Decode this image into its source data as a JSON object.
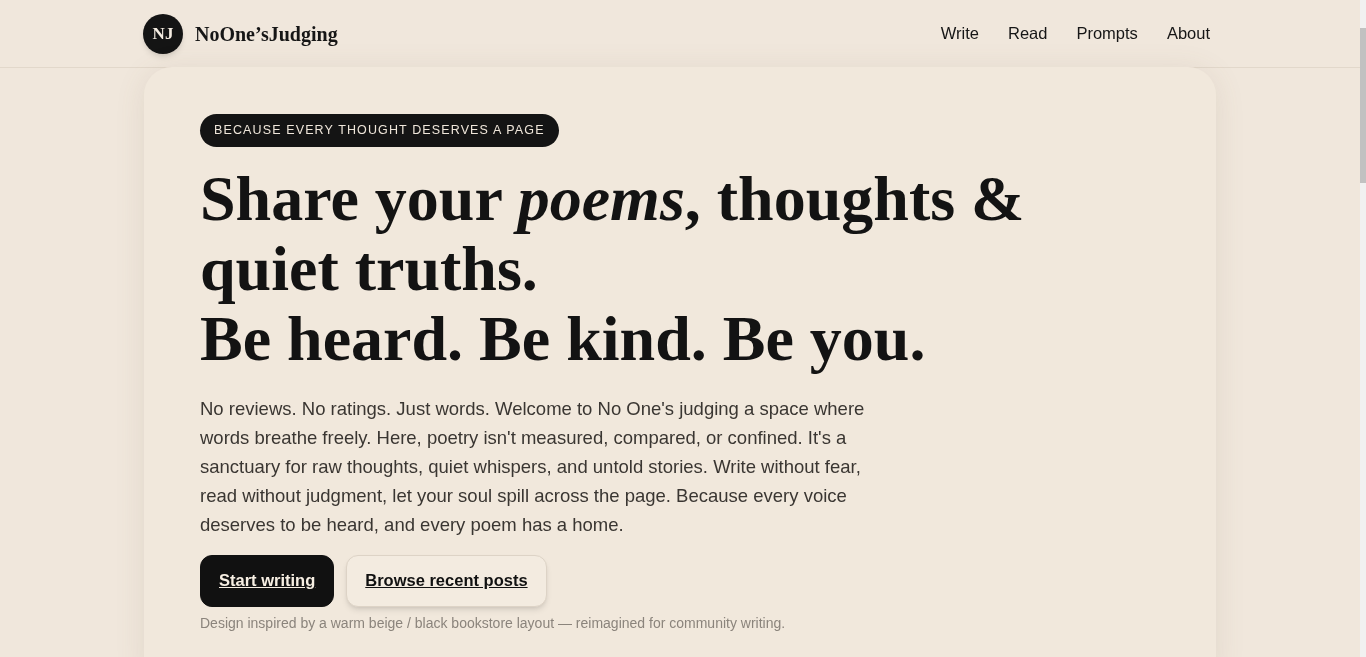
{
  "brand": {
    "initials": "NJ",
    "name": "NoOne’sJudging"
  },
  "nav": [
    "Write",
    "Read",
    "Prompts",
    "About"
  ],
  "hero": {
    "tagline": "BECAUSE EVERY THOUGHT DESERVES A PAGE",
    "headline": [
      "Share your *poems*, thoughts & quiet truths.",
      "Be heard. Be kind. Be you."
    ],
    "intro": "No reviews. No ratings. Just words. Welcome to No One's judging a space where words breathe freely. Here, poetry isn't measured, compared, or confined. It's a sanctuary for raw thoughts, quiet whispers, and untold stories. Write without fear, read without judgment, let your soul spill across the page. Because every voice deserves to be heard, and every poem has a home.",
    "buttons": [
      {
        "label": "Start writing",
        "kind": "primary"
      },
      {
        "label": "Browse recent posts",
        "kind": "secondary"
      }
    ],
    "note": "Design inspired by a warm beige / black bookstore layout — reimagined for community writing."
  }
}
